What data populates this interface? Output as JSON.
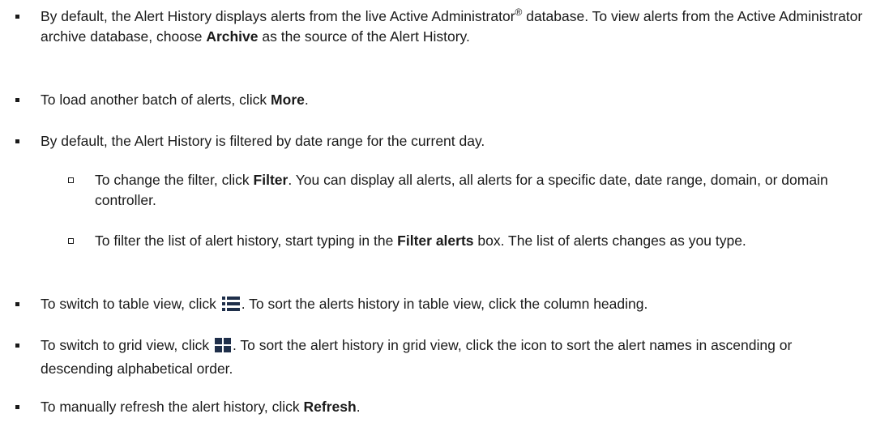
{
  "bullets": {
    "archive": {
      "pre": "By default, the Alert History displays alerts from the live Active Administrator",
      "sup": "®",
      "mid": " database. To view alerts from the Active Administrator archive database, choose ",
      "bold": "Archive",
      "post": " as the source of the Alert History."
    },
    "more": {
      "pre": "To load another batch of alerts, click ",
      "bold": "More",
      "post": "."
    },
    "filter_default": {
      "text": "By default, the Alert History is filtered by date range for the current day."
    },
    "filter_change": {
      "pre": "To change the filter, click ",
      "bold": "Filter",
      "post": ". You can display all alerts, all alerts for a specific date, date range, domain, or domain controller."
    },
    "filter_typing": {
      "pre": "To filter the list of alert history, start typing in the ",
      "bold": "Filter alerts",
      "post": " box. The list of alerts changes as you type."
    },
    "table_view": {
      "pre": "To switch to table view, click ",
      "icon": "list-view-icon",
      "post": ". To sort the alerts history in table view, click the column heading."
    },
    "grid_view": {
      "pre": "To switch to grid view, click ",
      "icon": "grid-view-icon",
      "post": ". To sort the alert history in grid view, click the icon to sort the alert names in ascending or descending alphabetical order."
    },
    "refresh": {
      "pre": "To manually refresh the alert history, click ",
      "bold": "Refresh",
      "post": "."
    }
  },
  "colors": {
    "text": "#1a1a1a",
    "icon": "#1f2f4a"
  }
}
